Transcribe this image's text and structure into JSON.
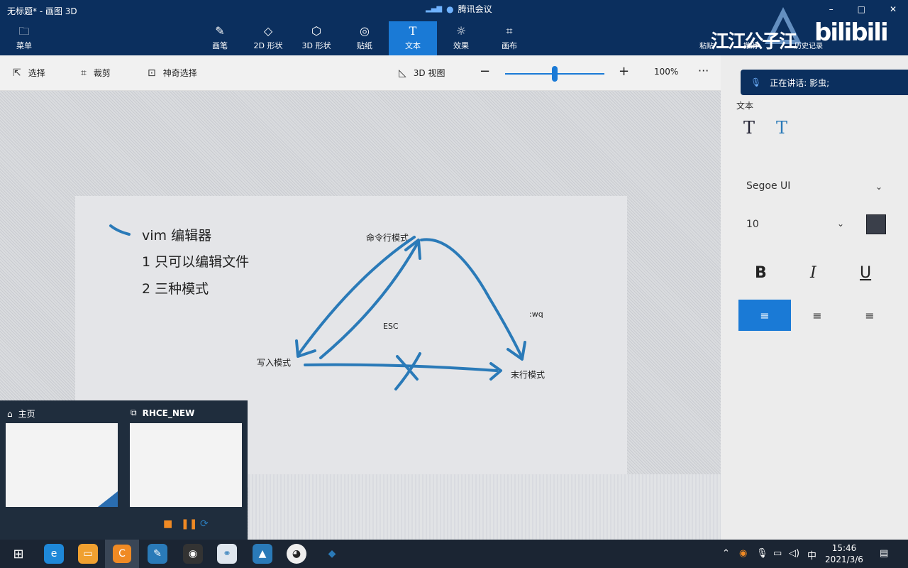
{
  "window": {
    "title": "无标题* - 画图 3D",
    "meeting": "腾讯会议",
    "controls": [
      "–",
      "□",
      "✕"
    ]
  },
  "ribbon": {
    "menu": "菜单",
    "tabs": [
      {
        "label": "画笔",
        "icon": "brush-icon"
      },
      {
        "label": "2D 形状",
        "icon": "2d-shapes-icon"
      },
      {
        "label": "3D 形状",
        "icon": "3d-shapes-icon"
      },
      {
        "label": "贴纸",
        "icon": "sticker-icon"
      },
      {
        "label": "文本",
        "icon": "text-icon"
      },
      {
        "label": "效果",
        "icon": "effects-icon"
      },
      {
        "label": "画布",
        "icon": "canvas-icon"
      }
    ],
    "active_tab": "文本",
    "right_buttons": [
      "粘贴",
      "撤消",
      "历史记录"
    ]
  },
  "watermark": {
    "text": "江江公子江",
    "brand": "bilibili"
  },
  "toolbar": {
    "select": "选择",
    "crop": "裁剪",
    "magic_select": "神奇选择",
    "view3d": "3D 视图",
    "zoom": "100%",
    "more": "···"
  },
  "speaking": {
    "label": "正在讲话: 影虫;"
  },
  "panel": {
    "section": "文本",
    "font": "Segoe UI",
    "size": "10",
    "bold": "B",
    "italic": "I",
    "underline": "U",
    "color": "#3a3f4a"
  },
  "canvas": {
    "lines": [
      "vim 编辑器",
      "1 只可以编辑文件",
      "2 三种模式"
    ],
    "labels": {
      "command": "命令行模式",
      "insert": "写入模式",
      "lastline": "末行模式",
      "esc": "ESC",
      "wq": ":wq"
    }
  },
  "popup": {
    "home": "主页",
    "session": "RHCE_NEW"
  },
  "taskbar": {
    "ime": "中",
    "time": "15:46",
    "date": "2021/3/6"
  }
}
